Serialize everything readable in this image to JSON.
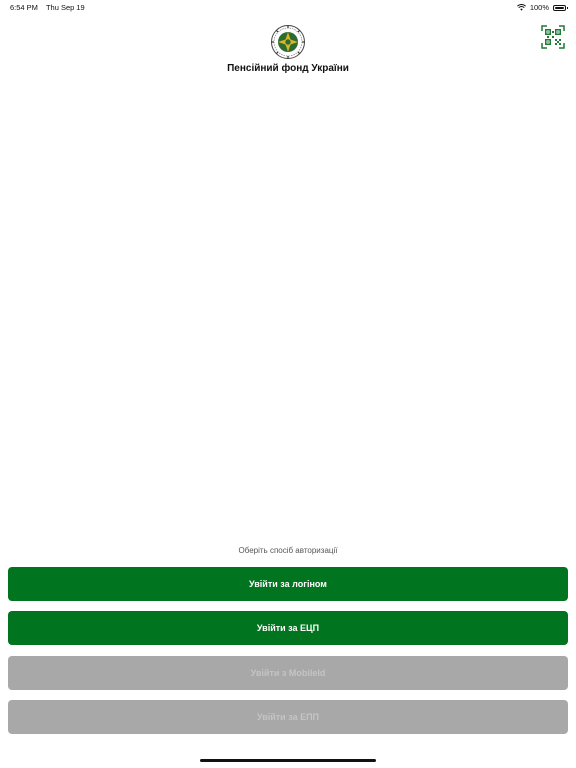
{
  "status_bar": {
    "time": "6:54 PM",
    "date": "Thu Sep 19",
    "battery": "100%"
  },
  "header": {
    "title": "Пенсійний фонд України",
    "logo_icon": "pension-fund-emblem-icon",
    "qr_icon": "qr-scan-icon"
  },
  "auth": {
    "prompt": "Оберіть спосіб авторизації",
    "login_button": "Увійти за логіном",
    "ecp_button": "Увійти за ЕЦП",
    "mobileid_button": "Увійти з MobileId",
    "epp_button": "Увійти за ЕПП"
  },
  "colors": {
    "primary_green": "#00741e",
    "disabled_gray": "#a8a8a8"
  }
}
